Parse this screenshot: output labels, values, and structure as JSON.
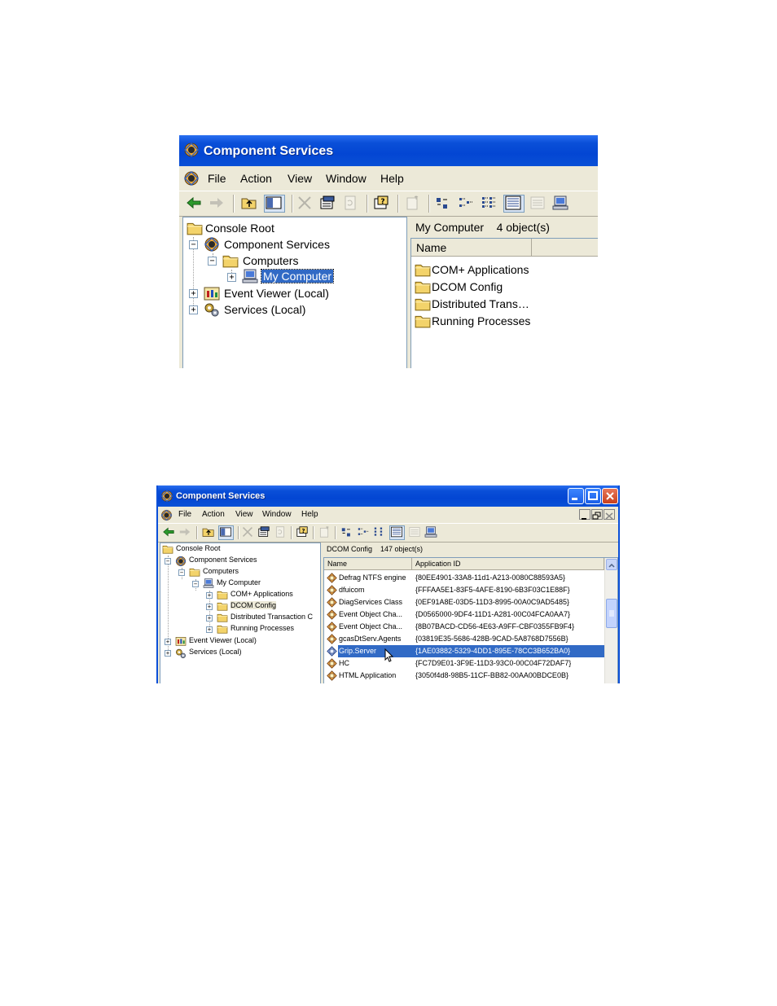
{
  "window1": {
    "title": "Component Services",
    "menu": [
      "File",
      "Action",
      "View",
      "Window",
      "Help"
    ],
    "tree": {
      "console_root": "Console Root",
      "component_services": "Component Services",
      "computers": "Computers",
      "my_computer": "My Computer",
      "event_viewer": "Event Viewer (Local)",
      "services": "Services (Local)"
    },
    "right": {
      "header": "My Computer    4 object(s)",
      "col_name": "Name",
      "items": [
        "COM+ Applications",
        "DCOM Config",
        "Distributed Trans…",
        "Running Processes"
      ]
    }
  },
  "window2": {
    "title": "Component Services",
    "menu": [
      "File",
      "Action",
      "View",
      "Window",
      "Help"
    ],
    "tree": {
      "console_root": "Console Root",
      "component_services": "Component Services",
      "computers": "Computers",
      "my_computer": "My Computer",
      "com_apps": "COM+ Applications",
      "dcom_config": "DCOM Config",
      "distributed": "Distributed Transaction C",
      "running": "Running Processes",
      "event_viewer": "Event Viewer (Local)",
      "services": "Services (Local)"
    },
    "right": {
      "header": "DCOM Config    147 object(s)",
      "col_name": "Name",
      "col_appid": "Application ID",
      "rows": [
        {
          "name": "Defrag NTFS engine",
          "id": "{80EE4901-33A8-11d1-A213-0080C88593A5}"
        },
        {
          "name": "dfuicom",
          "id": "{FFFAA5E1-83F5-4AFE-8190-6B3F03C1E88F}"
        },
        {
          "name": "DiagServices Class",
          "id": "{0EF91A8E-03D5-11D3-8995-00A0C9AD5485}"
        },
        {
          "name": "Event Object Cha...",
          "id": "{D0565000-9DF4-11D1-A281-00C04FCA0AA7}"
        },
        {
          "name": "Event Object Cha...",
          "id": "{8B07BACD-CD56-4E63-A9FF-CBF0355FB9F4}"
        },
        {
          "name": "gcasDtServ.Agents",
          "id": "{03819E35-5686-428B-9CAD-5A8768D7556B}"
        },
        {
          "name": "Grip.Server",
          "id": "{1AE03882-5329-4DD1-895E-78CC3B652BA0}"
        },
        {
          "name": "HC",
          "id": "{FC7D9E01-3F9E-11D3-93C0-00C04F72DAF7}"
        },
        {
          "name": "HTML Application",
          "id": "{3050f4d8-98B5-11CF-BB82-00AA00BDCE0B}"
        }
      ]
    }
  },
  "colors": {
    "titlebar": "#0346d3",
    "selection": "#316ac5",
    "window_bg": "#ece9d8",
    "folder": "#f3d36a"
  },
  "icons": {
    "app": "component-services-icon",
    "folder": "folder-icon",
    "computer": "computer-icon",
    "event_viewer": "event-viewer-icon",
    "services": "gears-icon",
    "dcom_app": "dcom-app-icon"
  }
}
